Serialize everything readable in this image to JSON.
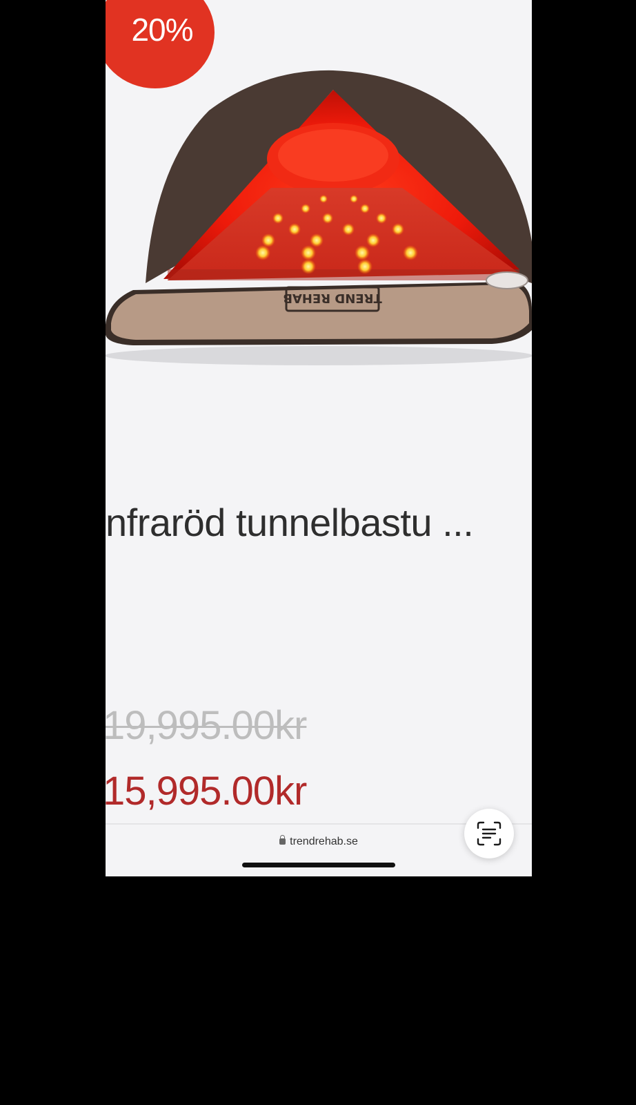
{
  "badge": {
    "discount_label": "20%"
  },
  "product": {
    "title": "nfraröd tunnelbastu ...",
    "image_brand_text": "TREND REHAB",
    "old_price": "19,995.00kr",
    "new_price": "15,995.00kr"
  },
  "browser": {
    "url": "trendrehab.se"
  },
  "icons": {
    "badge": "discount-badge",
    "scan": "live-text-scan-icon",
    "lock": "lock-icon"
  },
  "colors": {
    "badge": "#e13322",
    "sale_price": "#b12a2a",
    "old_price": "#bdbdbd",
    "background": "#f4f4f6"
  }
}
